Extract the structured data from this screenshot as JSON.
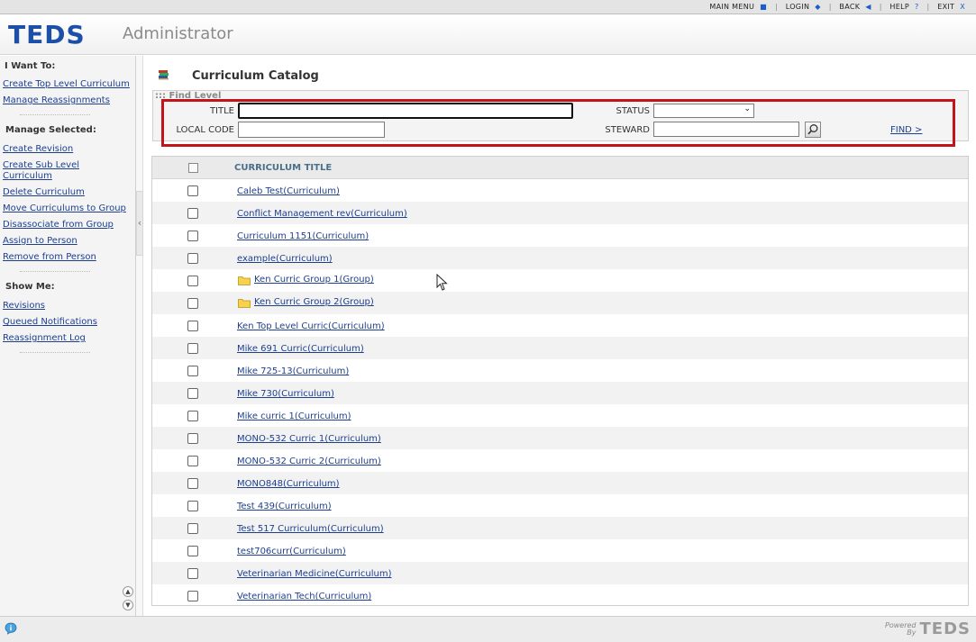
{
  "topnav": {
    "items": [
      {
        "label": "MAIN MENU",
        "glyph": "■"
      },
      {
        "label": "LOGIN",
        "glyph": "◆"
      },
      {
        "label": "BACK",
        "glyph": "◀"
      },
      {
        "label": "HELP",
        "glyph": "?"
      },
      {
        "label": "EXIT",
        "glyph": "X"
      }
    ]
  },
  "header": {
    "logo": "TEDS",
    "app_title": "Administrator"
  },
  "sidebar": {
    "i_want_to": {
      "heading": "I Want To:",
      "links": [
        "Create Top Level Curriculum",
        "Manage Reassignments"
      ]
    },
    "manage_selected": {
      "heading": "Manage Selected:",
      "links": [
        "Create Revision",
        "Create Sub Level Curriculum",
        "Delete Curriculum",
        "Move Curriculums to Group",
        "Disassociate from Group",
        "Assign to Person",
        "Remove from Person"
      ]
    },
    "show_me": {
      "heading": "Show Me:",
      "links": [
        "Revisions",
        "Queued Notifications",
        "Reassignment Log"
      ]
    }
  },
  "main": {
    "page_title": "Curriculum Catalog",
    "find": {
      "title": "Find Level",
      "title_label": "TITLE",
      "title_value": "",
      "local_code_label": "LOCAL CODE",
      "local_code_value": "",
      "status_label": "STATUS",
      "status_value": "",
      "steward_label": "STEWARD",
      "steward_value": "",
      "find_link": "FIND >"
    },
    "table": {
      "column_header": "CURRICULUM TITLE",
      "rows": [
        {
          "title": "Caleb Test(Curriculum)",
          "group": false
        },
        {
          "title": "Conflict Management rev(Curriculum)",
          "group": false
        },
        {
          "title": "Curriculum 1151(Curriculum)",
          "group": false
        },
        {
          "title": "example(Curriculum)",
          "group": false
        },
        {
          "title": "Ken Curric Group 1(Group)",
          "group": true
        },
        {
          "title": "Ken Curric Group 2(Group)",
          "group": true
        },
        {
          "title": "Ken Top Level Curric(Curriculum)",
          "group": false
        },
        {
          "title": "Mike 691 Curric(Curriculum)",
          "group": false
        },
        {
          "title": "Mike 725-13(Curriculum)",
          "group": false
        },
        {
          "title": "Mike 730(Curriculum)",
          "group": false
        },
        {
          "title": "Mike curric 1(Curriculum)",
          "group": false
        },
        {
          "title": "MONO-532 Curric 1(Curriculum)",
          "group": false
        },
        {
          "title": "MONO-532 Curric 2(Curriculum)",
          "group": false
        },
        {
          "title": "MONO848(Curriculum)",
          "group": false
        },
        {
          "title": "Test 439(Curriculum)",
          "group": false
        },
        {
          "title": "Test 517 Curriculum(Curriculum)",
          "group": false
        },
        {
          "title": "test706curr(Curriculum)",
          "group": false
        },
        {
          "title": "Veterinarian Medicine(Curriculum)",
          "group": false
        },
        {
          "title": "Veterinarian Tech(Curriculum)",
          "group": false
        }
      ]
    }
  },
  "footer": {
    "powered_line1": "Powered",
    "powered_line2": "By",
    "logo": "TEDS"
  },
  "colors": {
    "brand": "#1b4fa8",
    "link": "#1d3f8f",
    "highlight": "#c4141a"
  }
}
